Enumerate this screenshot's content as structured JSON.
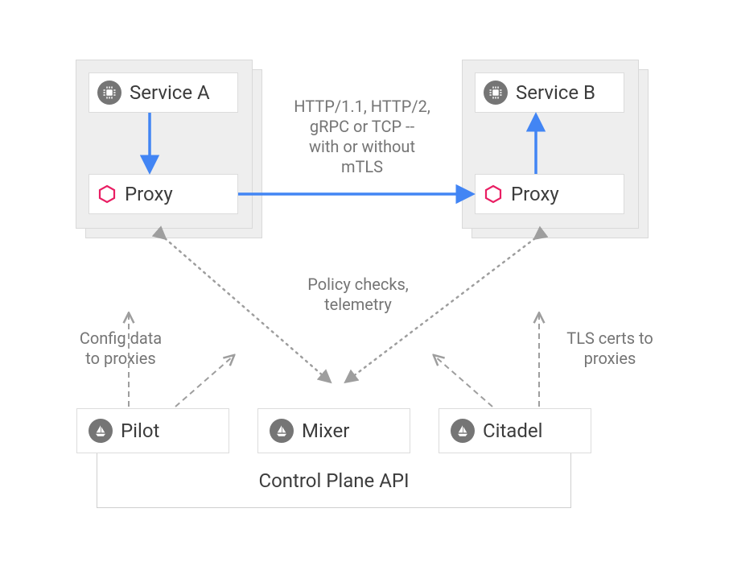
{
  "diagram": {
    "serviceA": {
      "label": "Service A"
    },
    "serviceB": {
      "label": "Service B"
    },
    "proxyA": {
      "label": "Proxy"
    },
    "proxyB": {
      "label": "Proxy"
    },
    "protocols_line1": "HTTP/1.1, HTTP/2,",
    "protocols_line2": "gRPC or TCP --",
    "protocols_line3": "with or without",
    "protocols_line4": "mTLS",
    "policy_line1": "Policy checks,",
    "policy_line2": "telemetry",
    "config_line1": "Config data",
    "config_line2": "to proxies",
    "tls_line1": "TLS certs to",
    "tls_line2": "proxies",
    "pilot": {
      "label": "Pilot"
    },
    "mixer": {
      "label": "Mixer"
    },
    "citadel": {
      "label": "Citadel"
    },
    "controlPlane": {
      "label": "Control Plane API"
    },
    "colors": {
      "blue": "#4285f4",
      "magenta": "#e91e63",
      "grey": "#9e9e9e",
      "darkgrey": "#757575"
    }
  }
}
